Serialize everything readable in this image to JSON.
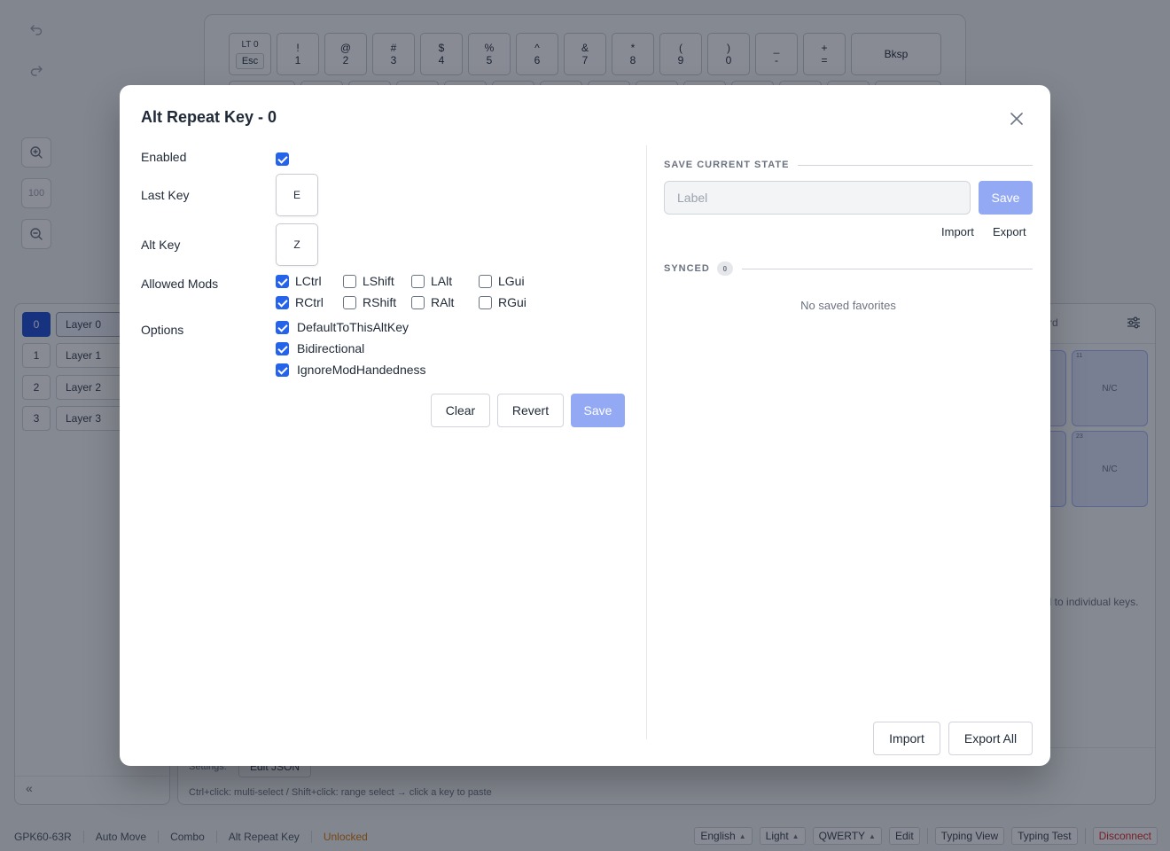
{
  "toolbar": {
    "zoom_level": "100"
  },
  "keyboard": {
    "keys": [
      {
        "top": "LT 0",
        "bottom": "Esc"
      },
      {
        "top": "!",
        "bottom": "1"
      },
      {
        "top": "@",
        "bottom": "2"
      },
      {
        "top": "#",
        "bottom": "3"
      },
      {
        "top": "$",
        "bottom": "4"
      },
      {
        "top": "%",
        "bottom": "5"
      },
      {
        "top": "^",
        "bottom": "6"
      },
      {
        "top": "&",
        "bottom": "7"
      },
      {
        "top": "*",
        "bottom": "8"
      },
      {
        "top": "(",
        "bottom": "9"
      },
      {
        "top": ")",
        "bottom": "0"
      },
      {
        "top": "_",
        "bottom": "-"
      },
      {
        "top": "+",
        "bottom": "="
      },
      {
        "top": "",
        "bottom": "Bksp"
      }
    ]
  },
  "layers": {
    "items": [
      {
        "num": "0",
        "name": "Layer 0"
      },
      {
        "num": "1",
        "name": "Layer 1"
      },
      {
        "num": "2",
        "name": "Layer 2"
      },
      {
        "num": "3",
        "name": "Layer 3"
      }
    ],
    "collapse_glyph": "«"
  },
  "main_panel": {
    "header_fragment": "rd",
    "slots": [
      {
        "index": "11",
        "label": "N/C"
      },
      {
        "index": "23",
        "label": "N/C"
      }
    ],
    "hint_fragment": "ed to individual keys.",
    "settings_label": "Settings:",
    "edit_json_label": "Edit JSON",
    "footer_hint": "Ctrl+click: multi-select / Shift+click: range select → click a key to paste"
  },
  "statusbar": {
    "device": "GPK60-63R",
    "auto_move": "Auto Move",
    "combo": "Combo",
    "alt_repeat_key": "Alt Repeat Key",
    "lock_state": "Unlocked",
    "language": "English",
    "theme": "Light",
    "layout": "QWERTY",
    "edit": "Edit",
    "typing_view": "Typing View",
    "typing_test": "Typing Test",
    "disconnect": "Disconnect"
  },
  "modal": {
    "title": "Alt Repeat Key - 0",
    "enabled_label": "Enabled",
    "enabled": true,
    "last_key_label": "Last Key",
    "last_key_value": "E",
    "alt_key_label": "Alt Key",
    "alt_key_value": "Z",
    "allowed_mods_label": "Allowed Mods",
    "mods": [
      {
        "label": "LCtrl",
        "checked": true
      },
      {
        "label": "LShift",
        "checked": false
      },
      {
        "label": "LAlt",
        "checked": false
      },
      {
        "label": "LGui",
        "checked": false
      },
      {
        "label": "RCtrl",
        "checked": true
      },
      {
        "label": "RShift",
        "checked": false
      },
      {
        "label": "RAlt",
        "checked": false
      },
      {
        "label": "RGui",
        "checked": false
      }
    ],
    "options_label": "Options",
    "options": [
      {
        "label": "DefaultToThisAltKey",
        "checked": true
      },
      {
        "label": "Bidirectional",
        "checked": true
      },
      {
        "label": "IgnoreModHandedness",
        "checked": true
      }
    ],
    "clear_label": "Clear",
    "revert_label": "Revert",
    "save_label": "Save",
    "favorites": {
      "save_state_heading": "SAVE CURRENT STATE",
      "label_placeholder": "Label",
      "save_label": "Save",
      "import_label": "Import",
      "export_label": "Export",
      "synced_heading": "SYNCED",
      "synced_count": "0",
      "empty_text": "No saved favorites",
      "import_all_label": "Import",
      "export_all_label": "Export All"
    }
  },
  "colors": {
    "accent": "#2563eb",
    "accent_disabled": "#93a9f3",
    "warning": "#d97706",
    "danger": "#dc2626"
  }
}
